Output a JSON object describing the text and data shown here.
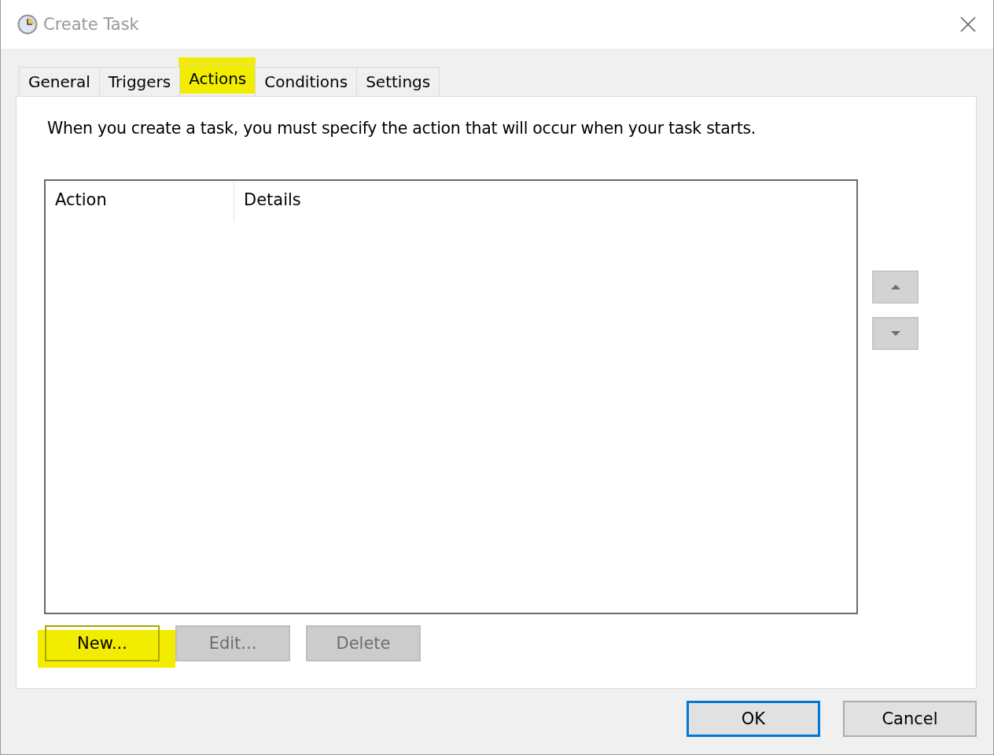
{
  "window": {
    "title": "Create Task"
  },
  "tabs": [
    {
      "label": "General",
      "selected": false,
      "highlighted": false
    },
    {
      "label": "Triggers",
      "selected": false,
      "highlighted": false
    },
    {
      "label": "Actions",
      "selected": true,
      "highlighted": true
    },
    {
      "label": "Conditions",
      "selected": false,
      "highlighted": false
    },
    {
      "label": "Settings",
      "selected": false,
      "highlighted": false
    }
  ],
  "instruction": "When you create a task, you must specify the action that will occur when your task starts.",
  "table": {
    "columns": [
      "Action",
      "Details"
    ]
  },
  "reorder_buttons": [
    {
      "kind": "up",
      "disabled": true
    },
    {
      "kind": "down",
      "disabled": true
    }
  ],
  "action_buttons": [
    {
      "label": "New...",
      "disabled": false,
      "highlighted": true
    },
    {
      "label": "Edit...",
      "disabled": true,
      "highlighted": false
    },
    {
      "label": "Delete",
      "disabled": true,
      "highlighted": false
    }
  ],
  "dialog_buttons": [
    {
      "label": "OK",
      "default": true
    },
    {
      "label": "Cancel",
      "default": false
    }
  ]
}
